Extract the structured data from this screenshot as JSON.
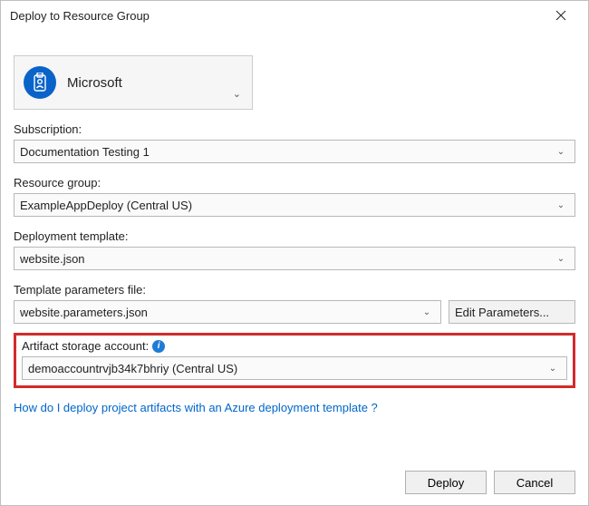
{
  "window": {
    "title": "Deploy to Resource Group"
  },
  "account": {
    "name": "Microsoft"
  },
  "subscription": {
    "label": "Subscription:",
    "value": "Documentation Testing 1"
  },
  "resourceGroup": {
    "label": "Resource group:",
    "value": "ExampleAppDeploy (Central US)"
  },
  "deploymentTemplate": {
    "label": "Deployment template:",
    "value": "website.json"
  },
  "parametersFile": {
    "label": "Template parameters file:",
    "value": "website.parameters.json",
    "editLabel": "Edit Parameters..."
  },
  "artifactStorage": {
    "label": "Artifact storage account:",
    "value": "demoaccountrvjb34k7bhriy (Central US)"
  },
  "helpLink": "How do I deploy project artifacts with an Azure deployment template ?",
  "buttons": {
    "deploy": "Deploy",
    "cancel": "Cancel"
  }
}
